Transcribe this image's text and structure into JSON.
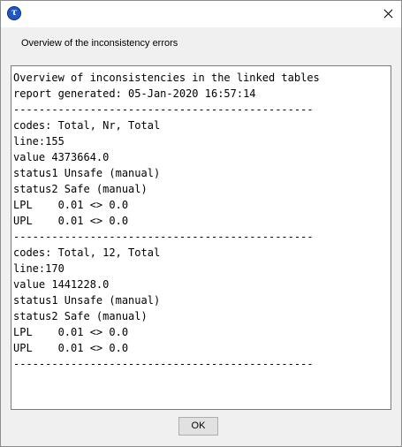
{
  "window": {
    "app_icon_glyph": "τ",
    "close_icon": "close-icon"
  },
  "header": {
    "label": "Overview of the inconsistency errors"
  },
  "report": {
    "lines": [
      "Overview of inconsistencies in the linked tables",
      "report generated: 05-Jan-2020 16:57:14",
      "-----------------------------------------------",
      "codes: Total, Nr, Total",
      "line:155",
      "value 4373664.0",
      "status1 Unsafe (manual)",
      "status2 Safe (manual)",
      "LPL    0.01 <> 0.0",
      "UPL    0.01 <> 0.0",
      "-----------------------------------------------",
      "codes: Total, 12, Total",
      "line:170",
      "value 1441228.0",
      "status1 Unsafe (manual)",
      "status2 Safe (manual)",
      "LPL    0.01 <> 0.0",
      "UPL    0.01 <> 0.0",
      "-----------------------------------------------"
    ]
  },
  "footer": {
    "ok_label": "OK"
  }
}
